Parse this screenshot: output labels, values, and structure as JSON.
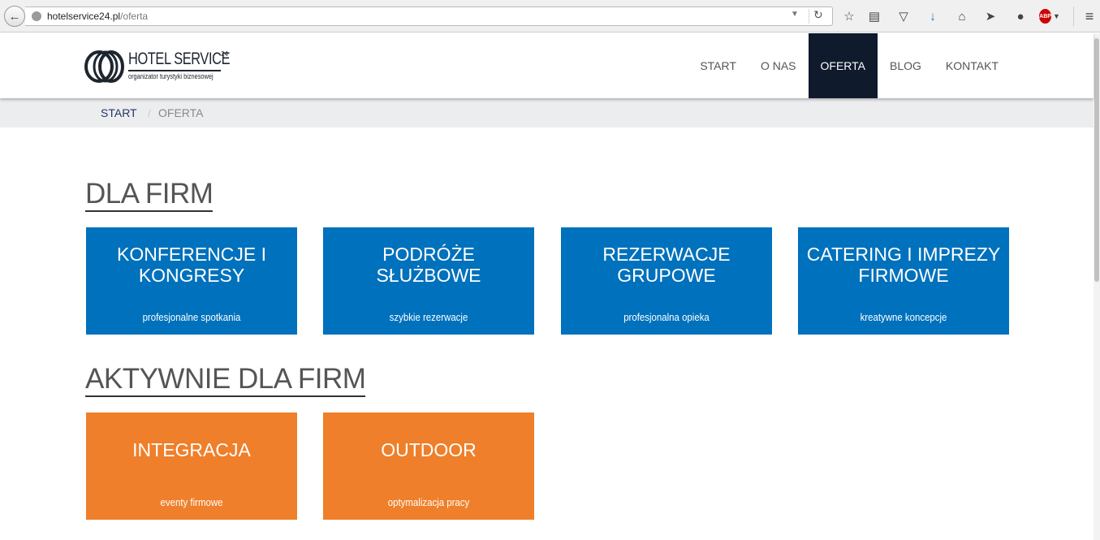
{
  "browser": {
    "url_host": "hotelservice24.pl",
    "url_path": "/oferta",
    "toolbar_icons": [
      "back-arrow-icon",
      "globe-icon",
      "dropdown-arrow-icon",
      "reload-icon",
      "star-icon",
      "reading-list-icon",
      "pocket-icon",
      "download-icon",
      "home-icon",
      "send-icon",
      "chat-icon",
      "adblock-icon",
      "menu-icon"
    ],
    "abp_label": "ABP"
  },
  "header": {
    "logo_title": "HOTEL SERVICE",
    "logo_sup": "24",
    "logo_subtitle": "organizator turystyki biznesowej",
    "nav": [
      "START",
      "O NAS",
      "OFERTA",
      "BLOG",
      "KONTAKT"
    ],
    "active_nav": "OFERTA"
  },
  "breadcrumb": {
    "start": "START",
    "separator": "/",
    "current": "OFERTA"
  },
  "sections": [
    {
      "title": "DLA FIRM",
      "tiles": [
        {
          "line1": "KONFERENCJE I",
          "line2": "KONGRESY",
          "subtitle": "profesjonalne spotkania"
        },
        {
          "line1": "PODRÓŻE",
          "line2": "SŁUŻBOWE",
          "subtitle": "szybkie rezerwacje"
        },
        {
          "line1": "REZERWACJE",
          "line2": "GRUPOWE",
          "subtitle": "profesjonalna opieka"
        },
        {
          "line1": "CATERING I IMPREZY",
          "line2": "FIRMOWE",
          "subtitle": "kreatywne koncepcje"
        }
      ]
    },
    {
      "title": "AKTYWNIE DLA FIRM",
      "tiles": [
        {
          "line1": "INTEGRACJA",
          "subtitle": "eventy firmowe"
        },
        {
          "line1": "OUTDOOR",
          "subtitle": "optymalizacja pracy"
        }
      ]
    }
  ],
  "colors": {
    "tile_blue": "#0071bc",
    "tile_orange": "#ef7f2a",
    "nav_active": "#0f1b2d",
    "breadcrumb_bg": "#ecedee"
  }
}
